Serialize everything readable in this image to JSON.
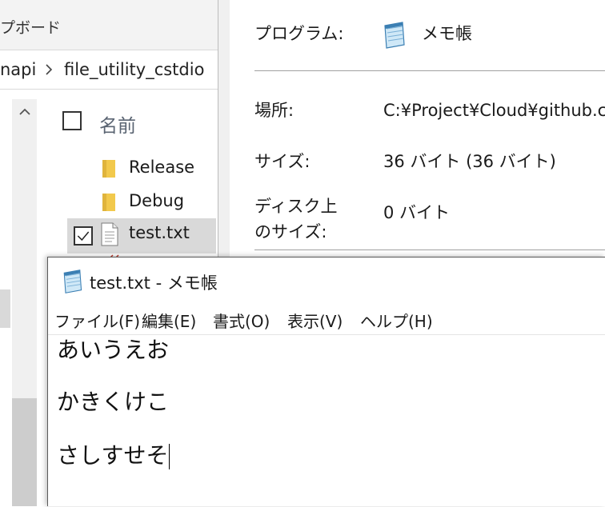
{
  "explorer": {
    "ribbon_label": "プボード",
    "breadcrumb": [
      "napi",
      "file_utility_cstdio"
    ],
    "name_column": "名前",
    "items": [
      {
        "name": "Release",
        "type": "folder"
      },
      {
        "name": "Debug",
        "type": "folder"
      },
      {
        "name": "test.txt",
        "type": "file",
        "selected": true
      }
    ]
  },
  "properties": {
    "program_label": "プログラム:",
    "program_value": "メモ帳",
    "location_label": "場所:",
    "location_value": "C:¥Project¥Cloud¥github.c",
    "size_label": "サイズ:",
    "size_value": "36 バイト (36 バイト)",
    "disk_size_label_1": "ディスク上",
    "disk_size_label_2": "のサイズ:",
    "disk_size_value": "0 バイト"
  },
  "notepad": {
    "title": "test.txt - メモ帳",
    "menu": [
      "ファイル(F)",
      "編集(E)",
      "書式(O)",
      "表示(V)",
      "ヘルプ(H)"
    ],
    "lines": [
      "あいうえお",
      "かきくけこ",
      "さしすせそ"
    ]
  },
  "colors": {
    "selection": "#d9d9d9",
    "folder": "#f2c94c",
    "dialog_bg": "#f0f0f0"
  }
}
